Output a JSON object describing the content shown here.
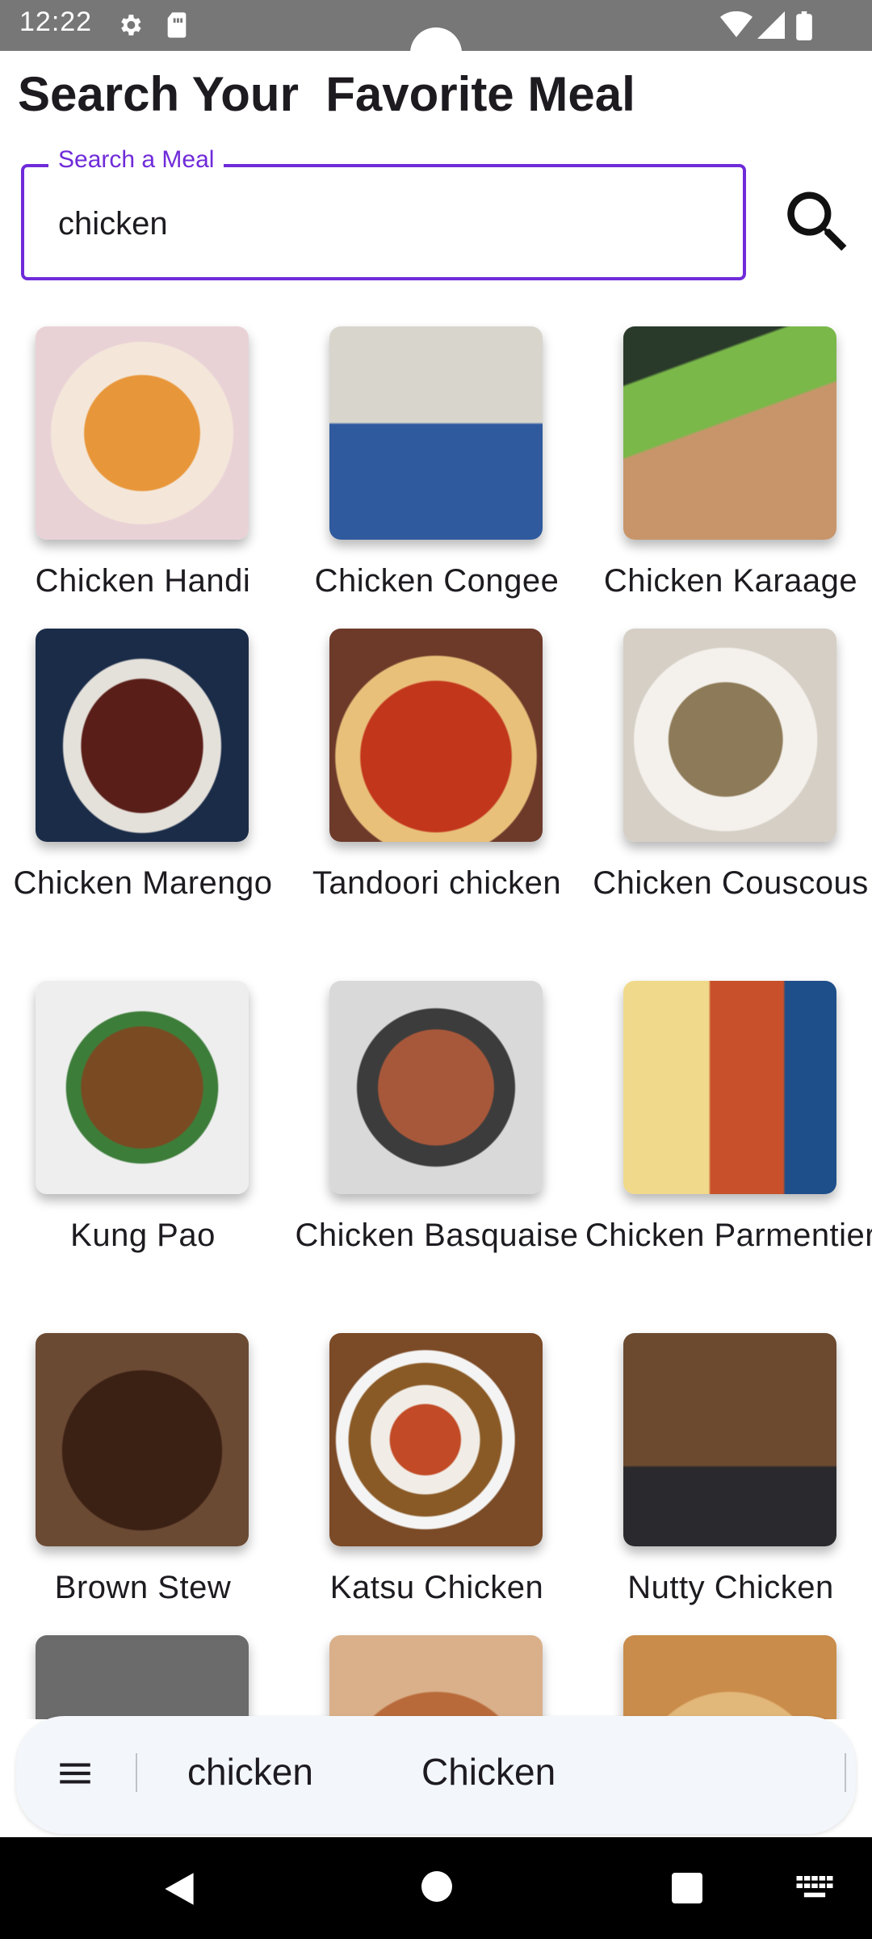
{
  "status_bar": {
    "time": "12:22",
    "icons": [
      "gear-icon",
      "sim-card-icon",
      "wifi-icon",
      "signal-icon",
      "battery-icon"
    ]
  },
  "header": {
    "title": "Search Your  Favorite Meal"
  },
  "search": {
    "label": "Search a Meal",
    "value": "chicken",
    "button_icon": "search-icon",
    "accent_color": "#6f2bd9"
  },
  "meals": [
    {
      "name": "Chicken Handi"
    },
    {
      "name": "Chicken Congee"
    },
    {
      "name": "Chicken Karaage"
    },
    {
      "name": "Chicken Marengo"
    },
    {
      "name": "Tandoori chicken"
    },
    {
      "name": "Chicken Couscous"
    },
    {
      "name": "Kung Pao"
    },
    {
      "name": "Chicken Basquaise"
    },
    {
      "name": "Chicken Parmentier"
    },
    {
      "name": "Brown Stew"
    },
    {
      "name": "Katsu Chicken"
    },
    {
      "name": "Nutty Chicken"
    },
    {
      "name": ""
    },
    {
      "name": ""
    },
    {
      "name": ""
    }
  ],
  "keyboard_suggestions": {
    "menu_icon": "menu-icon",
    "items": [
      "chicken",
      "Chicken"
    ]
  },
  "nav_bar": {
    "buttons": [
      "back-icon",
      "home-icon",
      "recents-icon",
      "keyboard-icon"
    ]
  }
}
